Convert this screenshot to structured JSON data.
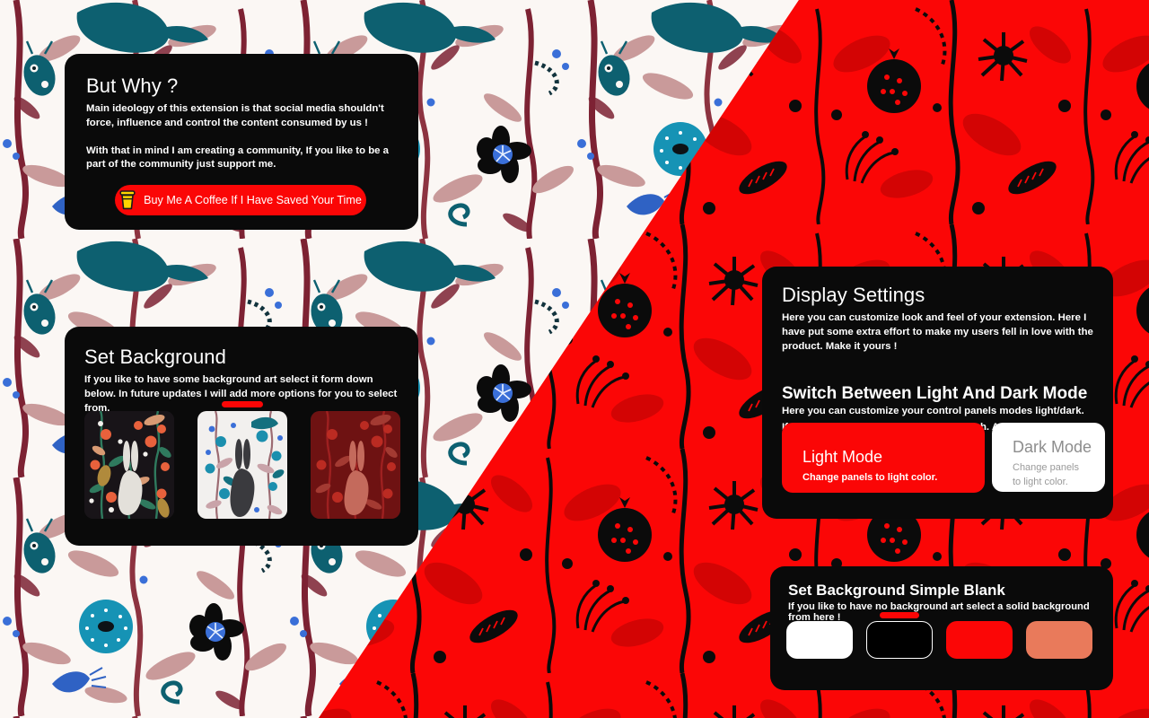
{
  "panels": {
    "why": {
      "title": "But Why ?",
      "paragraph1": "Main ideology of this extension is that social media shouldn't force, influence and control the content consumed by us !",
      "paragraph2": "With that in mind I am creating a community, If you like to be a part of the community just support me.",
      "coffee_button_label": "Buy Me A Coffee If I Have Saved Your Time",
      "coffee_icon": "coffee-cup-icon"
    },
    "set_background": {
      "title": "Set Background",
      "description": "If you like to have some background art select it form down below. In future updates I will add more options for you to select from.",
      "thumbnails": [
        {
          "name": "dark-floral-rabbit",
          "selected": false
        },
        {
          "name": "light-floral-rabbit",
          "selected": true
        },
        {
          "name": "red-floral-rabbit",
          "selected": false
        }
      ]
    },
    "display_settings": {
      "title": "Display Settings",
      "description": "Here you can customize look and feel of your extension. Here I have put some extra effort to make my users fell in love with the product. Make it yours !",
      "mode_section_title": "Switch Between Light And Dark Mode",
      "mode_description_line1": "Here you can customize your control panels modes light/dark.",
      "mode_description_line2": "If your eye like dark mode make it as such. As your eye whish !",
      "modes": [
        {
          "name": "Light Mode",
          "desc": "Change panels to light color.",
          "active": true
        },
        {
          "name": "Dark Mode",
          "desc": "Change panels to light color.",
          "active": false
        }
      ]
    },
    "set_background_blank": {
      "title": "Set Background Simple Blank",
      "description": "If you like to have no background art select a solid background from here !",
      "swatches": [
        {
          "name": "white-swatch",
          "color": "#ffffff",
          "selected": false,
          "bordered": false
        },
        {
          "name": "black-swatch",
          "color": "#000000",
          "selected": true,
          "bordered": true
        },
        {
          "name": "red-swatch",
          "color": "#fb0606",
          "selected": false,
          "bordered": false
        },
        {
          "name": "salmon-swatch",
          "color": "#e97a5b",
          "selected": false,
          "bordered": false
        }
      ]
    }
  },
  "colors": {
    "accent_red": "#fb0606",
    "panel_black": "#0a0a0a",
    "panel_text": "#ffffff",
    "background_light": "#fbf7f4",
    "background_red": "#fb0606",
    "teal": "#0d6070",
    "dusty_pink": "#c99a9a",
    "maroon": "#7d2233",
    "blue": "#2f62c4",
    "cyan": "#1693b5"
  }
}
